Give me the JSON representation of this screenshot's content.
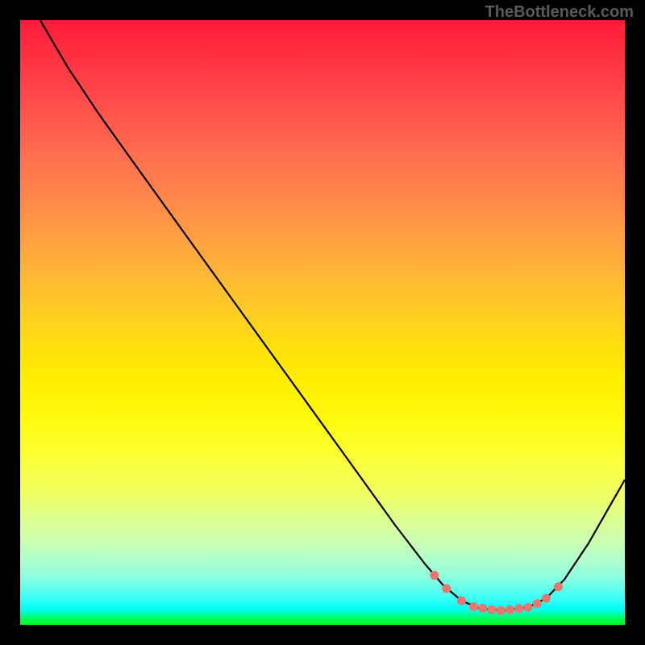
{
  "watermark": "TheBottleneck.com",
  "chart_data": {
    "type": "line",
    "title": "",
    "xlabel": "",
    "ylabel": "",
    "xlim": [
      0,
      100
    ],
    "ylim": [
      0,
      100
    ],
    "series": [
      {
        "name": "curve",
        "color": "#000000",
        "points": [
          {
            "x": 3.3,
            "y": 100
          },
          {
            "x": 8,
            "y": 92
          },
          {
            "x": 13,
            "y": 84.5
          },
          {
            "x": 18,
            "y": 77.5
          },
          {
            "x": 27,
            "y": 65
          },
          {
            "x": 40,
            "y": 47
          },
          {
            "x": 53,
            "y": 29
          },
          {
            "x": 62,
            "y": 16.5
          },
          {
            "x": 67,
            "y": 10
          },
          {
            "x": 70,
            "y": 6.5
          },
          {
            "x": 73,
            "y": 4
          },
          {
            "x": 76,
            "y": 2.7
          },
          {
            "x": 80,
            "y": 2.4
          },
          {
            "x": 84,
            "y": 2.9
          },
          {
            "x": 87,
            "y": 4.4
          },
          {
            "x": 90,
            "y": 7.5
          },
          {
            "x": 94,
            "y": 13.5
          },
          {
            "x": 100,
            "y": 24
          }
        ]
      },
      {
        "name": "highlight-dots",
        "color": "#e8776e",
        "points": [
          {
            "x": 68.5,
            "y": 8.2
          },
          {
            "x": 70.5,
            "y": 6
          },
          {
            "x": 73,
            "y": 4
          },
          {
            "x": 75,
            "y": 3
          },
          {
            "x": 76.5,
            "y": 2.75
          },
          {
            "x": 78,
            "y": 2.5
          },
          {
            "x": 79.5,
            "y": 2.4
          },
          {
            "x": 81,
            "y": 2.5
          },
          {
            "x": 82.5,
            "y": 2.7
          },
          {
            "x": 84,
            "y": 2.9
          },
          {
            "x": 85.5,
            "y": 3.5
          },
          {
            "x": 87,
            "y": 4.4
          },
          {
            "x": 89,
            "y": 6.3
          }
        ]
      }
    ]
  }
}
